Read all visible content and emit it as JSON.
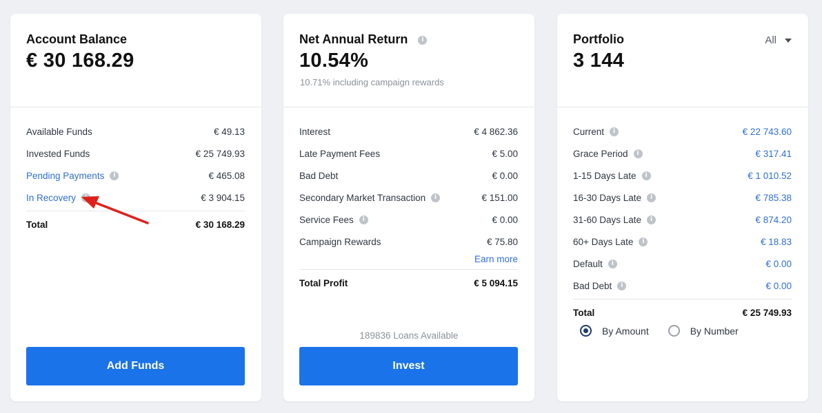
{
  "balance": {
    "title": "Account Balance",
    "amount": "€ 30 168.29",
    "rows": [
      {
        "label": "Available Funds",
        "value": "€ 49.13"
      },
      {
        "label": "Invested Funds",
        "value": "€ 25 749.93"
      },
      {
        "label": "Pending Payments",
        "value": "€ 465.08"
      },
      {
        "label": "In Recovery",
        "value": "€ 3 904.15"
      }
    ],
    "total_label": "Total",
    "total_value": "€ 30 168.29",
    "button": "Add Funds"
  },
  "return": {
    "title": "Net Annual Return",
    "amount": "10.54%",
    "subtitle": "10.71% including campaign rewards",
    "rows": [
      {
        "label": "Interest",
        "value": "€ 4 862.36"
      },
      {
        "label": "Late Payment Fees",
        "value": "€ 5.00"
      },
      {
        "label": "Bad Debt",
        "value": "€ 0.00"
      },
      {
        "label": "Secondary Market Transaction",
        "value": "€ 151.00"
      },
      {
        "label": "Service Fees",
        "value": "€ 0.00"
      },
      {
        "label": "Campaign Rewards",
        "value": "€ 75.80"
      }
    ],
    "earn_more": "Earn more",
    "total_label": "Total Profit",
    "total_value": "€ 5 094.15",
    "loans_available": "189836 Loans Available",
    "button": "Invest"
  },
  "portfolio": {
    "title": "Portfolio",
    "amount": "3 144",
    "filter": "All",
    "rows": [
      {
        "label": "Current",
        "value": "€ 22 743.60"
      },
      {
        "label": "Grace Period",
        "value": "€ 317.41"
      },
      {
        "label": "1-15 Days Late",
        "value": "€ 1 010.52"
      },
      {
        "label": "16-30 Days Late",
        "value": "€ 785.38"
      },
      {
        "label": "31-60 Days Late",
        "value": "€ 874.20"
      },
      {
        "label": "60+ Days Late",
        "value": "€ 18.83"
      },
      {
        "label": "Default",
        "value": "€ 0.00"
      },
      {
        "label": "Bad Debt",
        "value": "€ 0.00"
      }
    ],
    "total_label": "Total",
    "total_value": "€ 25 749.93",
    "radio_amount": "By Amount",
    "radio_number": "By Number"
  },
  "colors": {
    "accent": "#1a73e8",
    "link": "#2f6fd6",
    "arrow": "#e0201b"
  },
  "icons": {
    "info": "info-icon",
    "arrow": "red-arrow-annotation"
  }
}
